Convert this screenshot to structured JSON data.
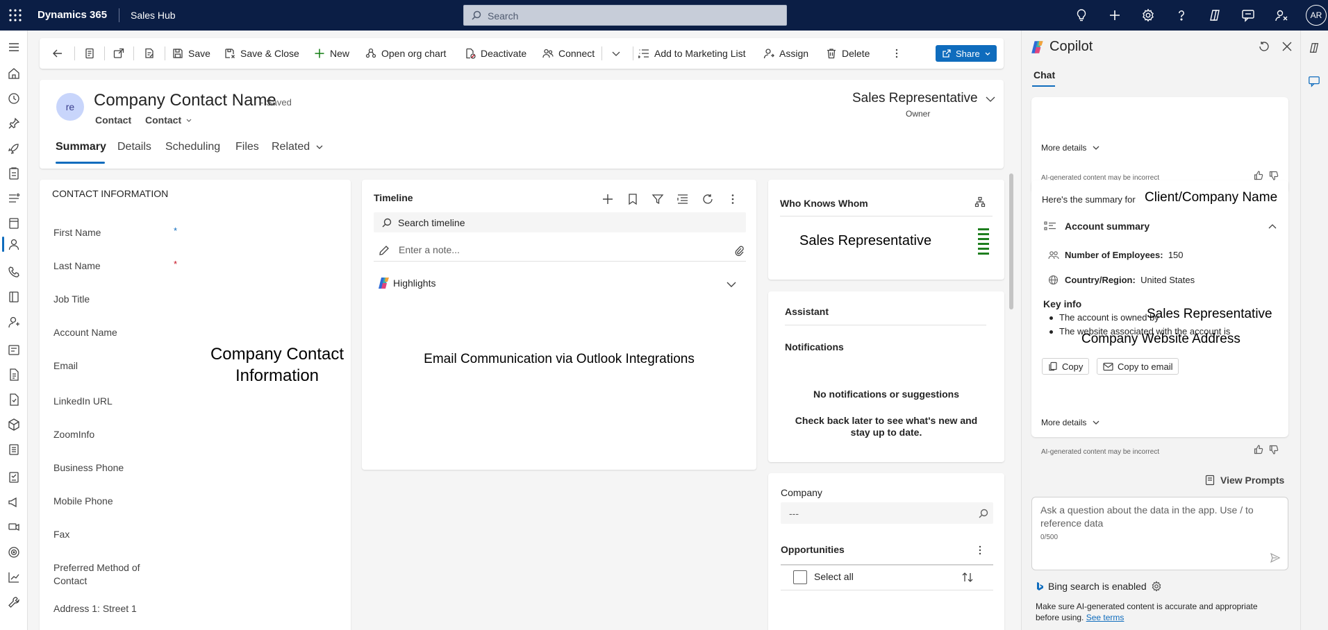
{
  "topbar": {
    "app_name": "Dynamics 365",
    "hub_name": "Sales Hub",
    "search_placeholder": "Search",
    "user_initials": "AR"
  },
  "leftrail": {
    "badge": "S"
  },
  "commandbar": {
    "save": "Save",
    "save_close": "Save & Close",
    "new": "New",
    "org_chart": "Open org chart",
    "deactivate": "Deactivate",
    "connect": "Connect",
    "add_marketing": "Add to Marketing List",
    "assign": "Assign",
    "delete": "Delete",
    "share": "Share"
  },
  "header": {
    "avatar_initials": "re",
    "title": "Company Contact Name",
    "saved_status": "- Saved",
    "entity": "Contact",
    "separator": "·",
    "form_selector": "Contact",
    "owner_name": "Sales Representative",
    "owner_label": "Owner",
    "tabs": [
      "Summary",
      "Details",
      "Scheduling",
      "Files",
      "Related"
    ]
  },
  "contact_info": {
    "section_title": "CONTACT INFORMATION",
    "fields": [
      "First Name",
      "Last Name",
      "Job Title",
      "Account Name",
      "Email",
      "LinkedIn URL",
      "ZoomInfo",
      "Business Phone",
      "Mobile Phone",
      "Fax",
      "Preferred Method of Contact",
      "Address 1: Street 1"
    ],
    "required_marker": "*",
    "placeholder_text": "Company Contact Information"
  },
  "timeline": {
    "title": "Timeline",
    "search_placeholder": "Search timeline",
    "note_placeholder": "Enter a note...",
    "highlights": "Highlights",
    "body_text": "Email Communication via Outlook Integrations"
  },
  "who_knows_whom": {
    "title": "Who Knows Whom",
    "person": "Sales Representative"
  },
  "assistant": {
    "title": "Assistant",
    "notifications": "Notifications",
    "empty_title": "No notifications or suggestions",
    "empty_body": "Check back later to see what's new and stay up to date."
  },
  "company_panel": {
    "company_label": "Company",
    "company_value": "---",
    "opportunities": "Opportunities",
    "select_all": "Select all"
  },
  "copilot": {
    "title": "Copilot",
    "tab_chat": "Chat",
    "more_details": "More details",
    "ai_disclaimer": "AI-generated content may be incorrect",
    "summary_intro": "Here's the summary for",
    "summary_company": "Client/Company Name",
    "account_summary": "Account summary",
    "employees_label": "Number of Employees:",
    "employees_value": "150",
    "country_label": "Country/Region:",
    "country_value": "United States",
    "key_info": "Key info",
    "owned_by_text": "The account is owned by",
    "owned_by_value": "Sales Representative",
    "website_text": "The website associated with the account is",
    "website_value": "Company Website Address",
    "copy": "Copy",
    "copy_email": "Copy to email",
    "view_prompts": "View Prompts",
    "ask_placeholder": "Ask a question about the data in the app. Use / to reference data",
    "char_count": "0/500",
    "bing": "Bing search is enabled",
    "disclaimer_text": "Make sure AI-generated content is accurate and appropriate before using.",
    "see_terms": "See terms"
  }
}
